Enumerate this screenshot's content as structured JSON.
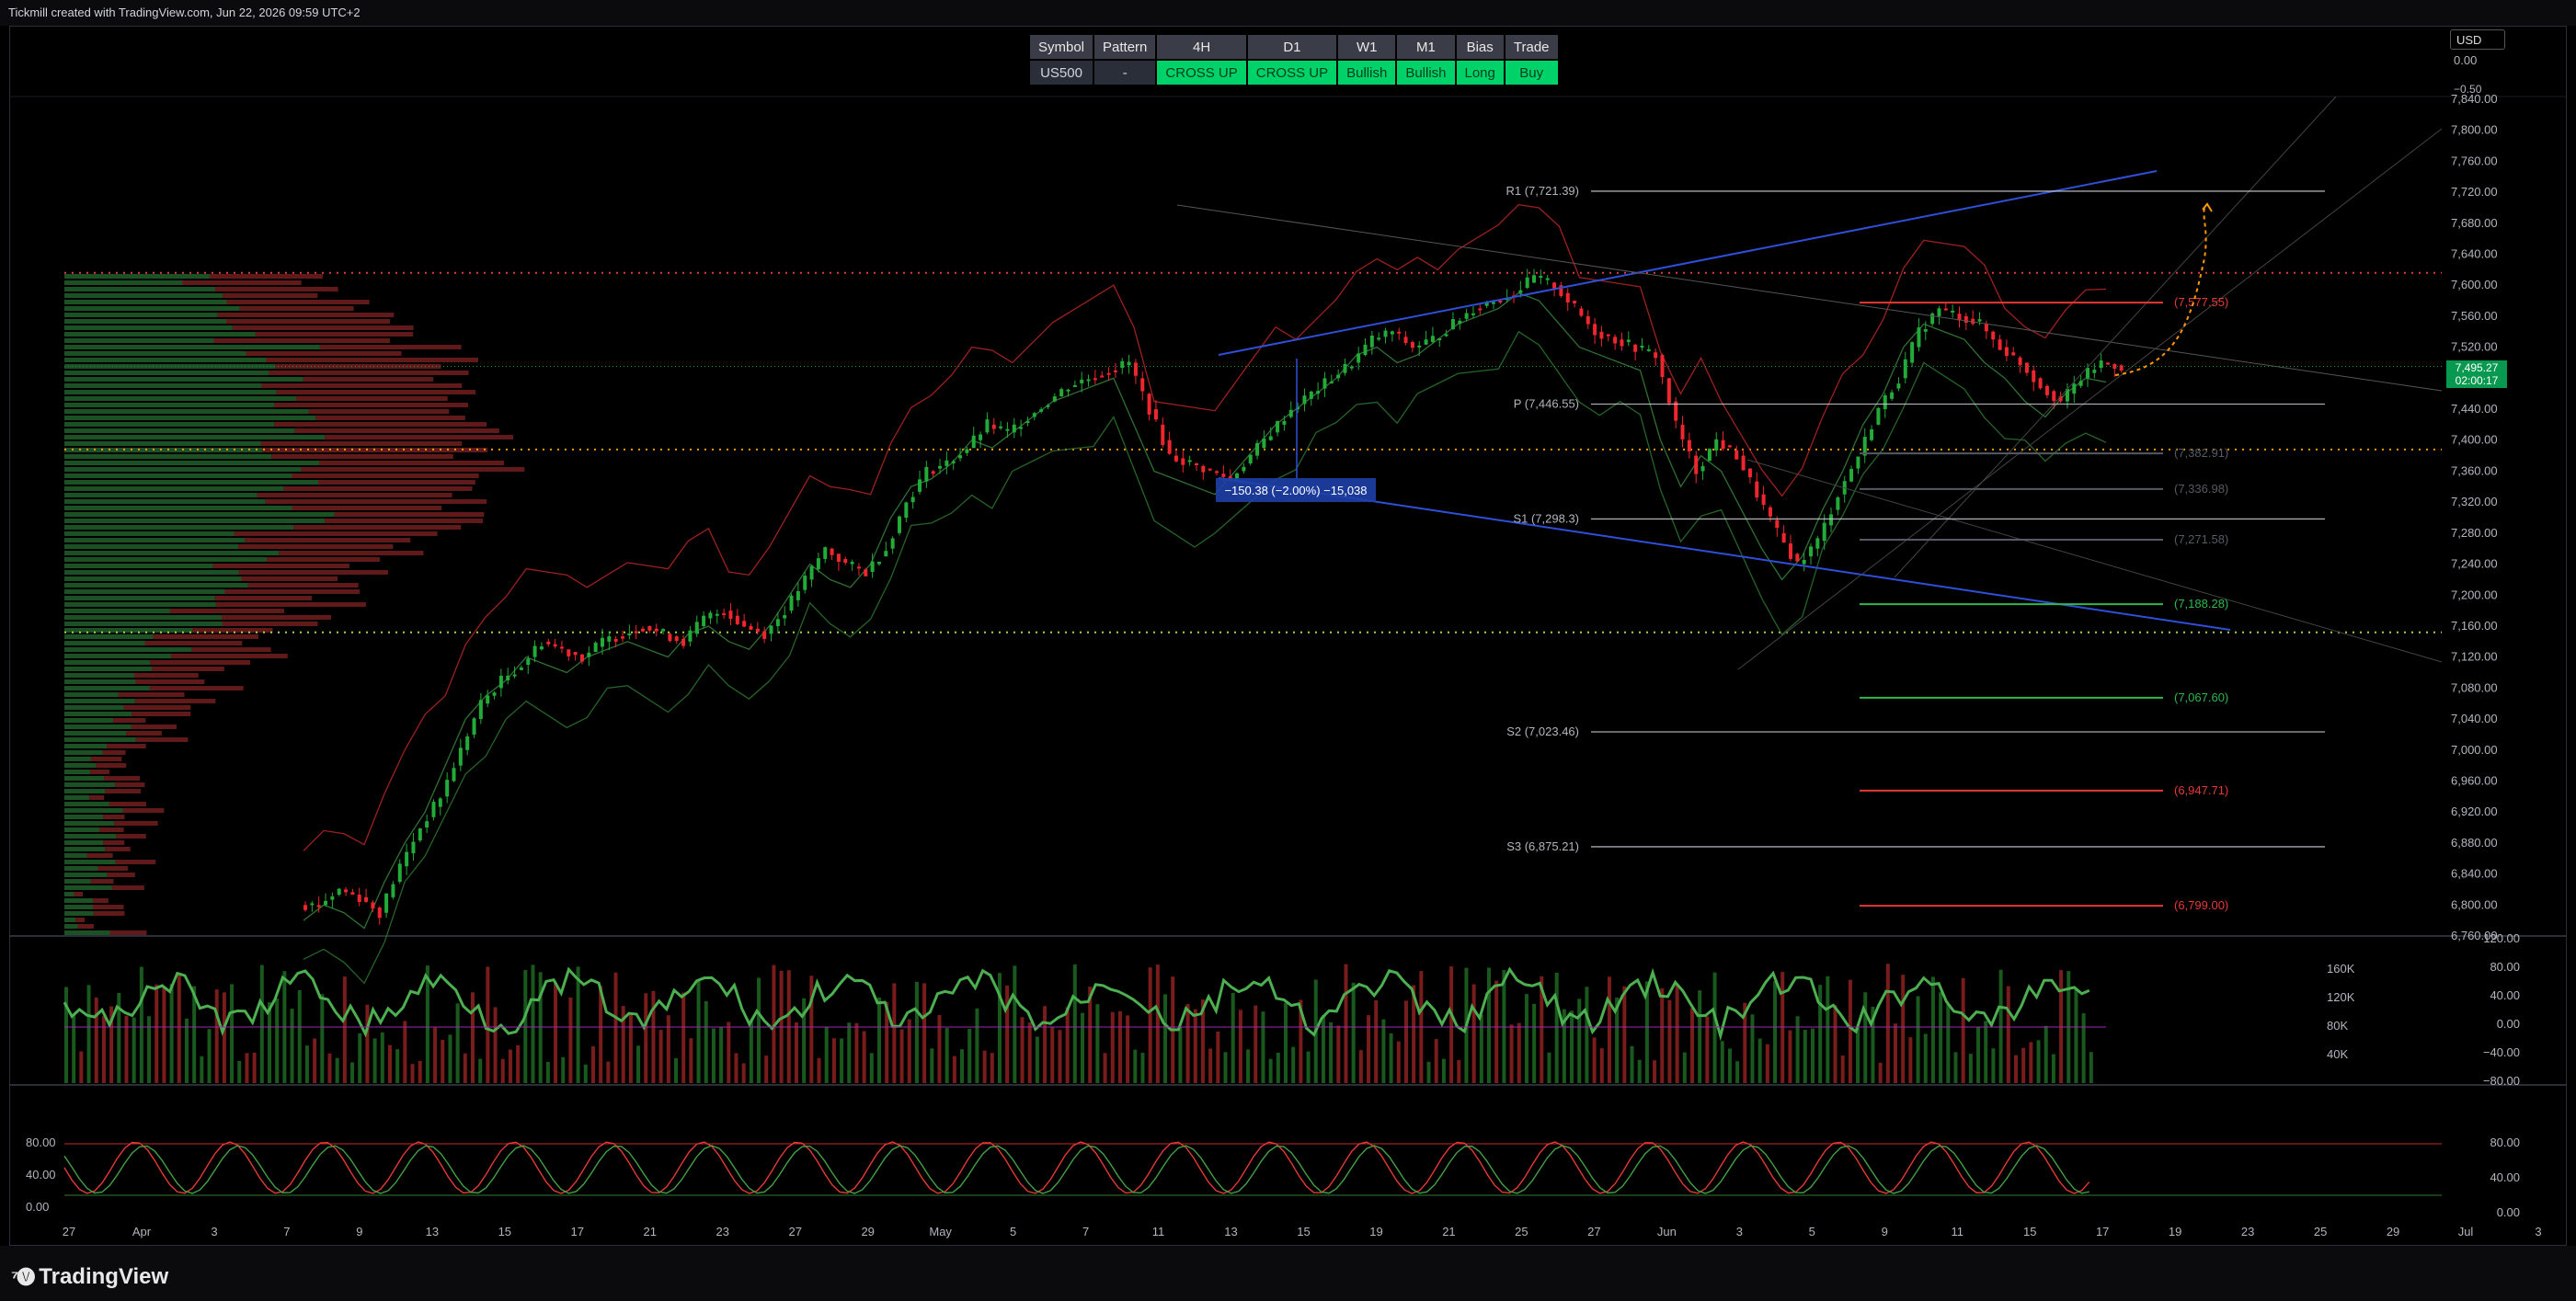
{
  "header": {
    "title": "Tickmill created with TradingView.com, Jun 22, 2026 09:59 UTC+2"
  },
  "footer": {
    "brand": "TradingView",
    "brand_icon": "tradingview-logo-icon"
  },
  "currency_button": "USD",
  "signal_table": {
    "headers": [
      "Symbol",
      "Pattern",
      "4H",
      "D1",
      "W1",
      "M1",
      "Bias",
      "Trade"
    ],
    "row": [
      "US500",
      "-",
      "CROSS UP",
      "CROSS UP",
      "Bullish",
      "Bullish",
      "Long",
      "Buy"
    ],
    "highlighted": [
      false,
      false,
      true,
      true,
      true,
      true,
      true,
      true
    ]
  },
  "colors": {
    "bull": "#26a69a",
    "bear": "#ef5350",
    "candle_up": "#22ab39",
    "candle_down": "#f0262f",
    "pivot": "#d1d4dc",
    "support_green": "#2eb84b",
    "resistance_red": "#e53935",
    "channel_blue": "#2f4fd8",
    "forecast": "#ff9800"
  },
  "current_price": {
    "value": "7,495.27",
    "countdown": "02:00:17"
  },
  "chart_data": [
    {
      "type": "candlestick",
      "title": "",
      "ylim": [
        6760,
        7840
      ],
      "price_axis_ticks": [
        "7,840.00",
        "7,800.00",
        "7,760.00",
        "7,720.00",
        "7,680.00",
        "7,640.00",
        "7,600.00",
        "7,560.00",
        "7,520.00",
        "7,480.00",
        "7,440.00",
        "7,400.00",
        "7,360.00",
        "7,320.00",
        "7,280.00",
        "7,240.00",
        "7,200.00",
        "7,160.00",
        "7,120.00",
        "7,080.00",
        "7,040.00",
        "7,000.00",
        "6,960.00",
        "6,920.00",
        "6,880.00",
        "6,840.00",
        "6,800.00",
        "6,760.00"
      ],
      "time_axis_ticks": [
        "27",
        "Apr",
        "3",
        "7",
        "9",
        "13",
        "15",
        "17",
        "21",
        "23",
        "27",
        "29",
        "May",
        "5",
        "7",
        "11",
        "13",
        "15",
        "19",
        "21",
        "25",
        "27",
        "Jun",
        "3",
        "5",
        "9",
        "11",
        "15",
        "17",
        "19",
        "23",
        "25",
        "29",
        "Jul",
        "3"
      ],
      "close_path": [
        6800,
        6820,
        6810,
        6790,
        6850,
        6900,
        6940,
        7000,
        7060,
        7090,
        7110,
        7140,
        7130,
        7120,
        7140,
        7150,
        7160,
        7150,
        7140,
        7170,
        7180,
        7160,
        7150,
        7180,
        7220,
        7260,
        7240,
        7230,
        7260,
        7320,
        7360,
        7370,
        7390,
        7420,
        7410,
        7430,
        7450,
        7470,
        7480,
        7490,
        7500,
        7440,
        7380,
        7370,
        7360,
        7350,
        7380,
        7410,
        7440,
        7460,
        7480,
        7500,
        7530,
        7540,
        7520,
        7530,
        7550,
        7570,
        7580,
        7590,
        7610,
        7600,
        7570,
        7540,
        7530,
        7520,
        7510,
        7420,
        7360,
        7400,
        7380,
        7330,
        7280,
        7240,
        7270,
        7330,
        7380,
        7440,
        7480,
        7540,
        7570,
        7560,
        7550,
        7520,
        7500,
        7470,
        7450,
        7480,
        7500,
        7495
      ],
      "pivot_levels": [
        {
          "label": "R1 (7,721.39)",
          "value": 7721.39
        },
        {
          "label": "P (7,446.55)",
          "value": 7446.55
        },
        {
          "label": "S1 (7,298.3)",
          "value": 7298.3
        },
        {
          "label": "S2 (7,023.46)",
          "value": 7023.46
        },
        {
          "label": "S3 (6,875.21)",
          "value": 6875.21
        }
      ],
      "levels_right": [
        {
          "label": "(7,577.55)",
          "value": 7577.55,
          "color": "#e53935"
        },
        {
          "label": "(7,382.91)",
          "value": 7382.91,
          "color": "#555a63"
        },
        {
          "label": "(7,336.98)",
          "value": 7336.98,
          "color": "#555a63"
        },
        {
          "label": "(7,271.58)",
          "value": 7271.58,
          "color": "#555a63"
        },
        {
          "label": "(7,188.28)",
          "value": 7188.28,
          "color": "#2eb84b"
        },
        {
          "label": "(7,067.60)",
          "value": 7067.6,
          "color": "#2eb84b"
        },
        {
          "label": "(6,947.71)",
          "value": 6947.71,
          "color": "#e53935"
        },
        {
          "label": "(6,799.00)",
          "value": 6799.0,
          "color": "#e53935"
        }
      ],
      "measure_label": "−150.38 (−2.00%) −15,038",
      "dotted_levels": [
        {
          "value": 7616,
          "color": "#e53935"
        },
        {
          "value": 7388,
          "color": "#ff9800"
        },
        {
          "value": 7152,
          "color": "#a5d63f"
        }
      ]
    },
    {
      "type": "bar",
      "title": "",
      "ylabel": "",
      "left_axis_ticks": [
        "160K",
        "120K",
        "80K",
        "40K"
      ],
      "right_axis_ticks": [
        "120.00",
        "80.00",
        "40.00",
        "0.00",
        "−40.00",
        "−80.00"
      ]
    },
    {
      "type": "line",
      "title": "",
      "axis_ticks": [
        "80.00",
        "40.00",
        "0.00"
      ],
      "left_ticks": [
        "80.00",
        "40.00",
        "0.00"
      ],
      "upper_band": 80,
      "lower_band": 20
    }
  ],
  "right_scale_top": [
    "0.00",
    "−0.50"
  ]
}
